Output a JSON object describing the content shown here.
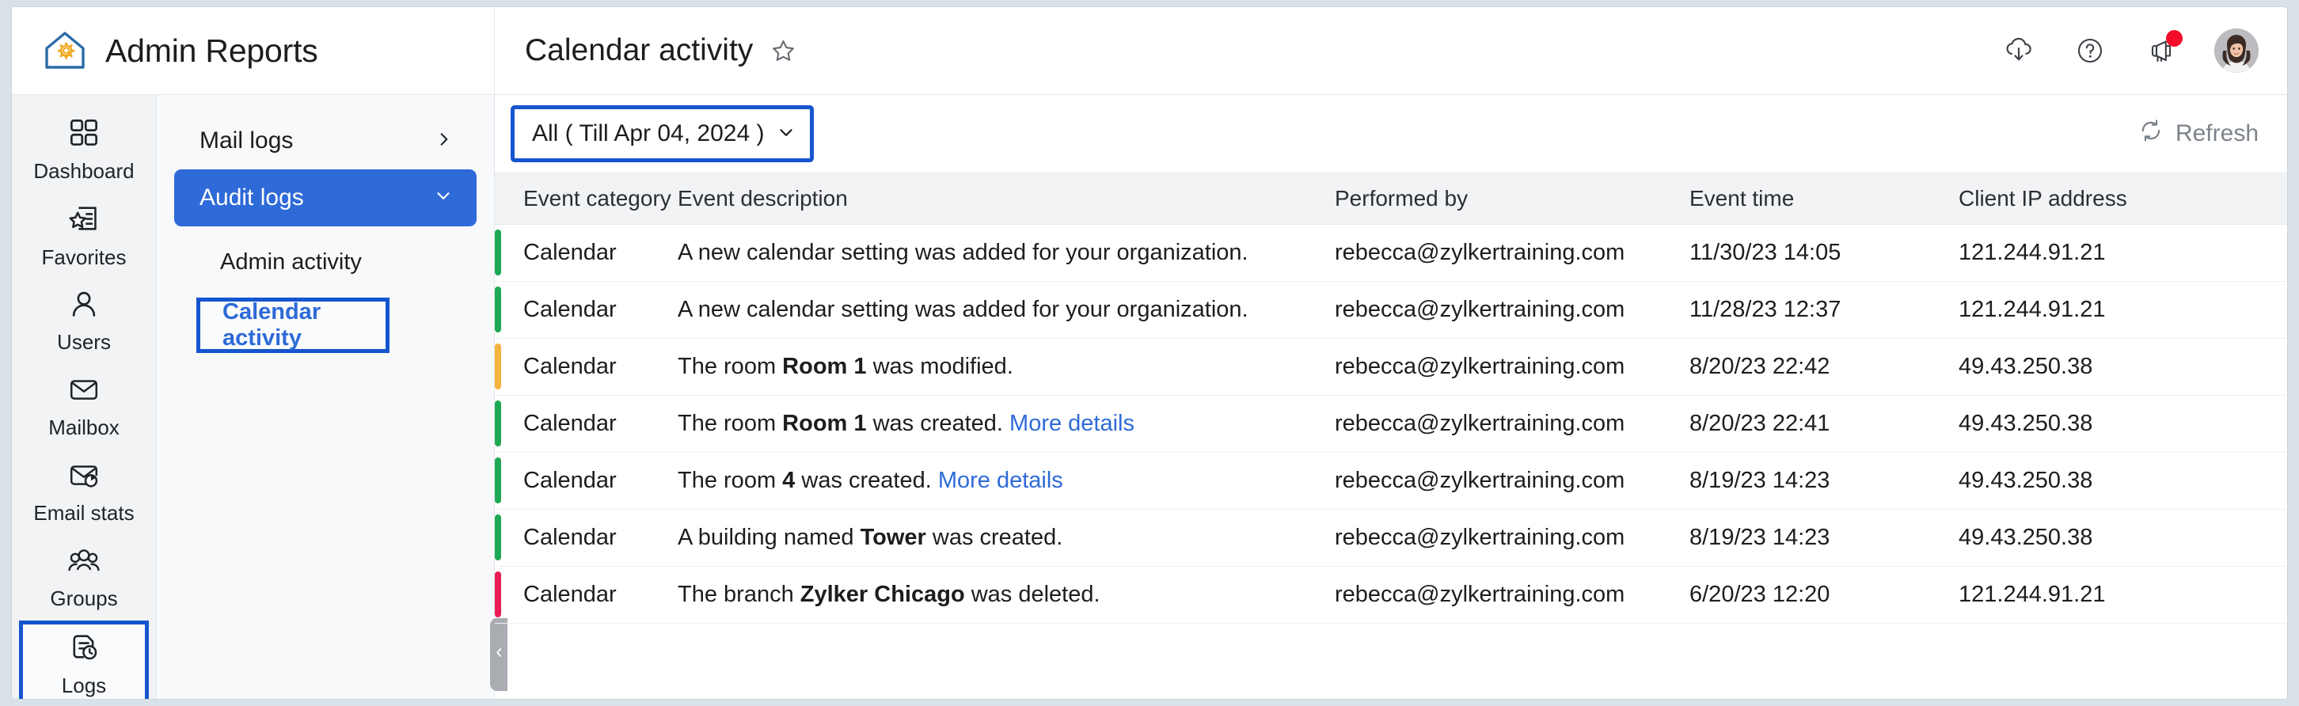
{
  "brand": {
    "title": "Admin Reports",
    "logo_icon": "house-gear-search-icon"
  },
  "header": {
    "page_title": "Calendar activity",
    "star_icon": "star-outline-icon",
    "actions": [
      {
        "name": "cloud-download-icon",
        "label": "Download"
      },
      {
        "name": "help-circle-icon",
        "label": "Help"
      },
      {
        "name": "megaphone-icon",
        "label": "Announcements",
        "badge": true
      }
    ],
    "avatar_label": "User profile"
  },
  "rail": {
    "items": [
      {
        "label": "Dashboard",
        "icon": "grid-icon",
        "selected": false
      },
      {
        "label": "Favorites",
        "icon": "star-document-icon",
        "selected": false
      },
      {
        "label": "Users",
        "icon": "user-icon",
        "selected": false
      },
      {
        "label": "Mailbox",
        "icon": "envelope-icon",
        "selected": false
      },
      {
        "label": "Email stats",
        "icon": "envelope-chart-icon",
        "selected": false
      },
      {
        "label": "Groups",
        "icon": "people-group-icon",
        "selected": false
      },
      {
        "label": "Logs",
        "icon": "document-clock-icon",
        "selected": true
      }
    ]
  },
  "subnav": {
    "items": [
      {
        "label": "Mail logs",
        "state": "collapsed",
        "icon": "chevron-right-icon"
      },
      {
        "label": "Audit logs",
        "state": "expanded",
        "icon": "chevron-down-icon"
      }
    ],
    "children": [
      {
        "label": "Admin activity",
        "highlighted": false
      },
      {
        "label": "Calendar activity",
        "highlighted": true
      }
    ],
    "collapse_icon": "chevron-left-icon"
  },
  "toolbar": {
    "filter_label": "All ( Till Apr 04, 2024 )",
    "filter_chevron": "chevron-down-icon",
    "refresh_label": "Refresh",
    "refresh_icon": "refresh-icon"
  },
  "table": {
    "columns": [
      "Event category",
      "Event description",
      "Performed by",
      "Event time",
      "Client IP address"
    ],
    "more_details_label": "More details",
    "rows": [
      {
        "accent": "#1fa855",
        "category": "Calendar",
        "desc_prefix": "A new calendar setting was added for your organization.",
        "desc_bold": "",
        "desc_suffix": "",
        "more_details": false,
        "performed_by": "rebecca@zylkertraining.com",
        "event_time": "11/30/23 14:05",
        "client_ip": "121.244.91.21"
      },
      {
        "accent": "#1fa855",
        "category": "Calendar",
        "desc_prefix": "A new calendar setting was added for your organization.",
        "desc_bold": "",
        "desc_suffix": "",
        "more_details": false,
        "performed_by": "rebecca@zylkertraining.com",
        "event_time": "11/28/23 12:37",
        "client_ip": "121.244.91.21"
      },
      {
        "accent": "#f5b23d",
        "category": "Calendar",
        "desc_prefix": "The room ",
        "desc_bold": "Room 1",
        "desc_suffix": " was modified.",
        "more_details": false,
        "performed_by": "rebecca@zylkertraining.com",
        "event_time": "8/20/23 22:42",
        "client_ip": "49.43.250.38"
      },
      {
        "accent": "#1fa855",
        "category": "Calendar",
        "desc_prefix": "The room ",
        "desc_bold": "Room 1",
        "desc_suffix": " was created. ",
        "more_details": true,
        "performed_by": "rebecca@zylkertraining.com",
        "event_time": "8/20/23 22:41",
        "client_ip": "49.43.250.38"
      },
      {
        "accent": "#1fa855",
        "category": "Calendar",
        "desc_prefix": "The room ",
        "desc_bold": "4",
        "desc_suffix": " was created. ",
        "more_details": true,
        "performed_by": "rebecca@zylkertraining.com",
        "event_time": "8/19/23 14:23",
        "client_ip": "49.43.250.38"
      },
      {
        "accent": "#1fa855",
        "category": "Calendar",
        "desc_prefix": "A building named ",
        "desc_bold": "Tower",
        "desc_suffix": " was created.",
        "more_details": false,
        "performed_by": "rebecca@zylkertraining.com",
        "event_time": "8/19/23 14:23",
        "client_ip": "49.43.250.38"
      },
      {
        "accent": "#ea1e56",
        "category": "Calendar",
        "desc_prefix": "The branch ",
        "desc_bold": "Zylker Chicago",
        "desc_suffix": " was deleted.",
        "more_details": false,
        "performed_by": "rebecca@zylkertraining.com",
        "event_time": "6/20/23 12:20",
        "client_ip": "121.244.91.21"
      }
    ]
  },
  "colors": {
    "accent_blue": "#2e6ad8",
    "highlight_border": "#1555cf",
    "created_green": "#1fa855",
    "modified_amber": "#f5b23d",
    "deleted_pink": "#ea1e56",
    "notification_red": "#f20c28"
  }
}
